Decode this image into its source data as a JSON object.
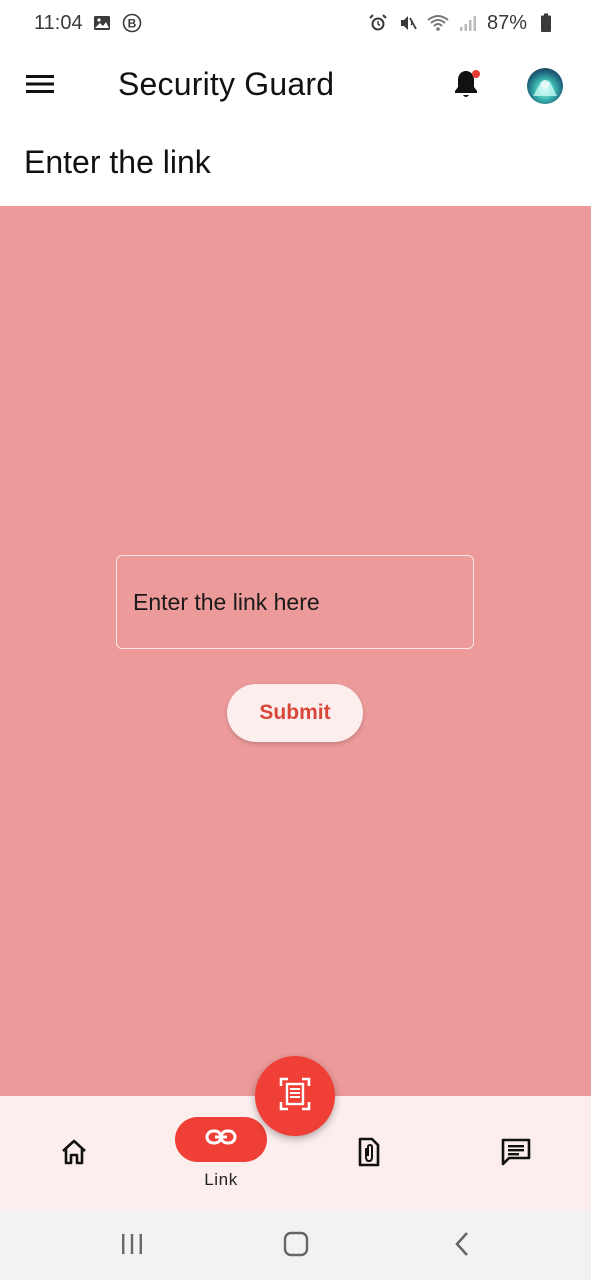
{
  "status_bar": {
    "time": "11:04",
    "battery": "87%",
    "icons": [
      "image-icon",
      "b-icon",
      "alarm-icon",
      "mute-icon",
      "wifi-icon",
      "signal-icon",
      "battery-icon"
    ]
  },
  "app_bar": {
    "title": "Security Guard",
    "notification_dot_color": "#e53935"
  },
  "page": {
    "heading": "Enter the link"
  },
  "form": {
    "link_placeholder": "Enter the link here",
    "link_value": "",
    "submit_label": "Submit"
  },
  "bottom_nav": {
    "items": [
      {
        "id": "home",
        "label": "",
        "icon": "home-icon",
        "active": false
      },
      {
        "id": "link",
        "label": "Link",
        "icon": "link-icon",
        "active": true
      },
      {
        "id": "file",
        "label": "",
        "icon": "file-attachment-icon",
        "active": false
      },
      {
        "id": "chat",
        "label": "",
        "icon": "chat-icon",
        "active": false
      }
    ],
    "fab_icon": "scan-document-icon"
  },
  "colors": {
    "content_bg": "#ec9a9a",
    "accent": "#ef3f36",
    "nav_bg": "#fdeeee",
    "submit_text": "#d9463a"
  }
}
